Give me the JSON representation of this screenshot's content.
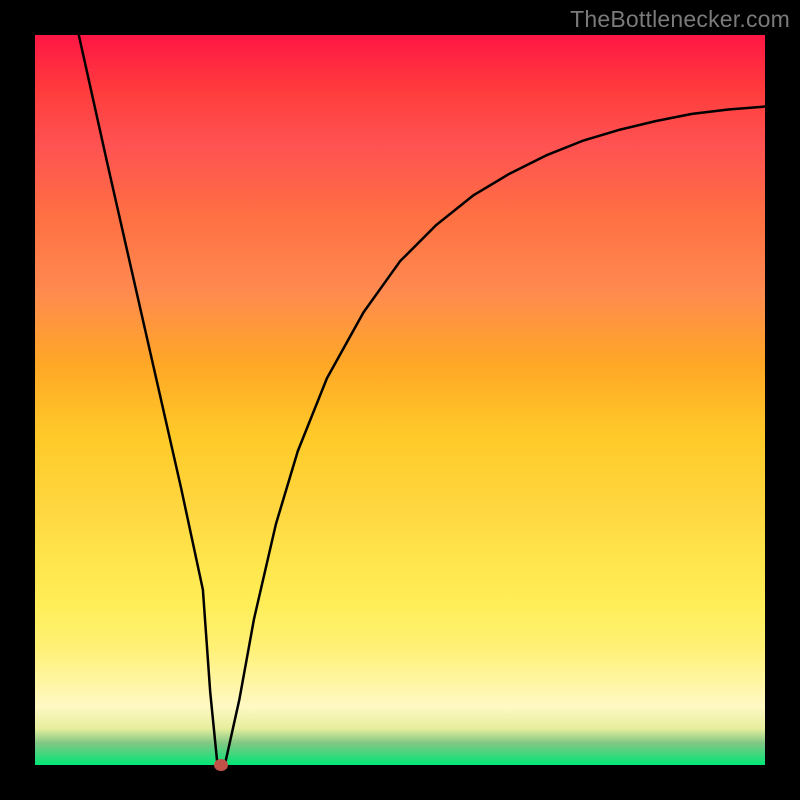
{
  "watermark": "TheBottlenecker.com",
  "chart_data": {
    "type": "line",
    "title": "",
    "xlabel": "",
    "ylabel": "",
    "xlim": [
      0,
      100
    ],
    "ylim": [
      0,
      100
    ],
    "series": [
      {
        "name": "bottleneck-curve",
        "x": [
          6,
          10,
          15,
          20,
          23,
          24,
          25,
          26,
          28,
          30,
          33,
          36,
          40,
          45,
          50,
          55,
          60,
          65,
          70,
          75,
          80,
          85,
          90,
          95,
          100
        ],
        "values": [
          100,
          82,
          60,
          38,
          24,
          10,
          0,
          0,
          9,
          20,
          33,
          43,
          53,
          62,
          69,
          74,
          78,
          81,
          83.5,
          85.5,
          87,
          88.2,
          89.2,
          89.8,
          90.2
        ]
      }
    ],
    "marker": {
      "x": 25.5,
      "y": 0
    },
    "gradient_stops": [
      {
        "pos": 0,
        "color": "#ff1744"
      },
      {
        "pos": 100,
        "color": "#00e676"
      }
    ]
  }
}
